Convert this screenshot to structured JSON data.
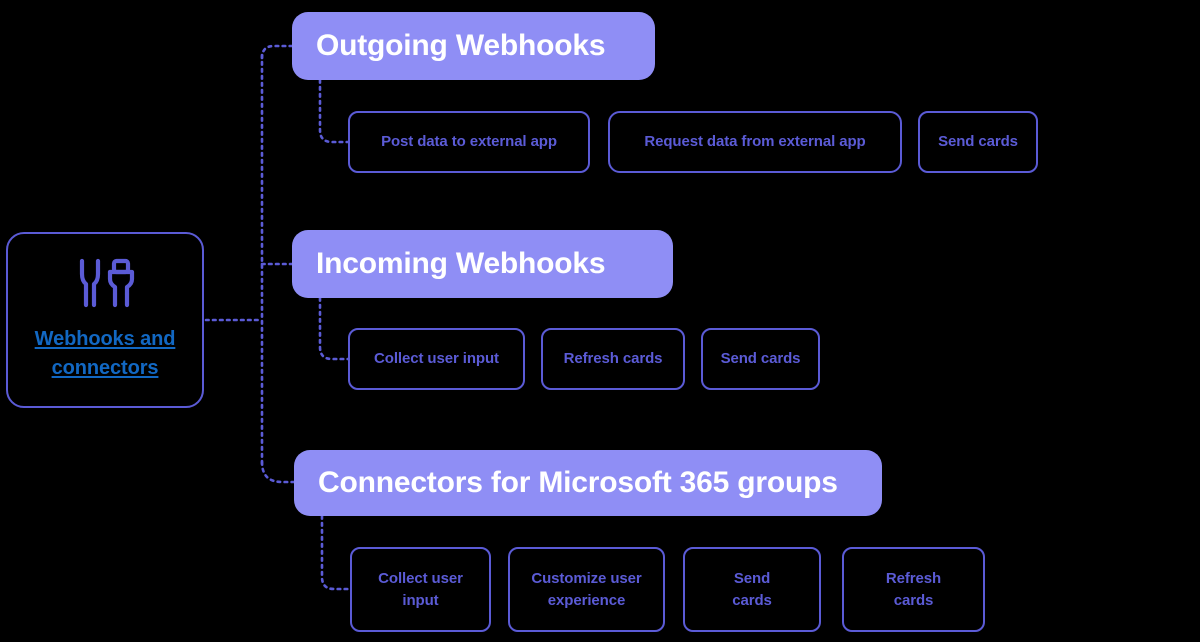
{
  "diagram": {
    "title": "Webhooks and connectors",
    "colors": {
      "background": "#000000",
      "header_fill": "#8f8ef5",
      "header_text": "#ffffff",
      "border": "#5b5bd6",
      "chip_text": "#5b5bd6",
      "link_text": "#1268c3",
      "connector": "#5b5bd6"
    }
  },
  "root": {
    "icon": "plug-connector-icon",
    "label_line1": "Webhooks and",
    "label_line2": "connectors",
    "label": "Webhooks and connectors"
  },
  "branches": [
    {
      "id": "outgoing-webhooks",
      "header": "Outgoing Webhooks",
      "children": [
        {
          "id": "post-data-to-external-app",
          "label": "Post data to external app"
        },
        {
          "id": "request-data-from-external-app",
          "label": "Request data from external app"
        },
        {
          "id": "send-cards",
          "label": "Send cards"
        }
      ]
    },
    {
      "id": "incoming-webhooks",
      "header": "Incoming Webhooks",
      "children": [
        {
          "id": "collect-user-input",
          "label": "Collect user input"
        },
        {
          "id": "refresh-cards",
          "label": "Refresh cards"
        },
        {
          "id": "send-cards",
          "label": "Send cards"
        }
      ]
    },
    {
      "id": "connectors-for-microsoft-365-groups",
      "header": "Connectors for Microsoft 365 groups",
      "children": [
        {
          "id": "collect-user-input",
          "label": "Collect user\ninput",
          "line1": "Collect user",
          "line2": "input"
        },
        {
          "id": "customize-user-experience",
          "label": "Customize user\nexperience",
          "line1": "Customize user",
          "line2": "experience"
        },
        {
          "id": "send-cards",
          "label": "Send\ncards",
          "line1": "Send",
          "line2": "cards"
        },
        {
          "id": "refresh-cards",
          "label": "Refresh\ncards",
          "line1": "Refresh",
          "line2": "cards"
        }
      ]
    }
  ]
}
